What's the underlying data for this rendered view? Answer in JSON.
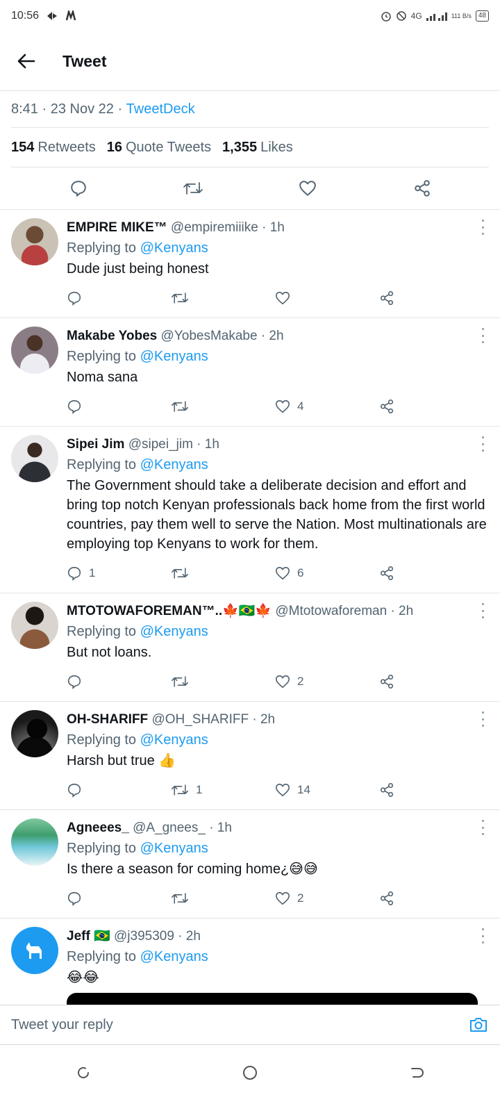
{
  "status_bar": {
    "time": "10:56",
    "network": "4G",
    "speed": "111 B/s",
    "battery": "48"
  },
  "header": {
    "title": "Tweet"
  },
  "tweet_meta": {
    "time": "8:41",
    "date": "23 Nov 22",
    "source": "TweetDeck"
  },
  "stats": {
    "retweets_count": "154",
    "retweets_label": "Retweets",
    "quotes_count": "16",
    "quotes_label": "Quote Tweets",
    "likes_count": "1,355",
    "likes_label": "Likes"
  },
  "replying_label": "Replying to",
  "replies": [
    {
      "name": "EMPIRE MIKE™",
      "handle": "@empiremiiike · 1h",
      "mention": "@Kenyans",
      "text": "Dude just being honest",
      "comments": "",
      "retweets": "",
      "likes": ""
    },
    {
      "name": "Makabe Yobes",
      "handle": "@YobesMakabe · 2h",
      "mention": "@Kenyans",
      "text": "Noma sana",
      "comments": "",
      "retweets": "",
      "likes": "4"
    },
    {
      "name": "Sipei Jim",
      "handle": "@sipei_jim · 1h",
      "mention": "@Kenyans",
      "text": "The Government should take a deliberate decision and effort and bring top notch Kenyan professionals back home from the  first world countries, pay them well to serve the Nation.  Most multinationals are employing top Kenyans to work for them.",
      "comments": "1",
      "retweets": "",
      "likes": "6"
    },
    {
      "name": "MTOTOWAFOREMAN™..🍁🇧🇷🍁",
      "handle": "@Mtotowaforeman · 2h",
      "mention": "@Kenyans",
      "text": "But not loans.",
      "comments": "",
      "retweets": "",
      "likes": "2"
    },
    {
      "name": "OH-SHARIFF",
      "handle": "@OH_SHARIFF · 2h",
      "mention": "@Kenyans",
      "text": "Harsh but true 👍",
      "comments": "",
      "retweets": "1",
      "likes": "14"
    },
    {
      "name": "Agneees_",
      "handle": "@A_gnees_ · 1h",
      "mention": "@Kenyans",
      "text": "Is there a season for coming home¿😅😅",
      "comments": "",
      "retweets": "",
      "likes": "2"
    },
    {
      "name": "Jeff 🇧🇷",
      "handle": "@j395309 · 2h",
      "mention": "@Kenyans",
      "text": "😂😂"
    }
  ],
  "composer": {
    "placeholder": "Tweet your reply"
  },
  "colors": {
    "accent": "#1d9bf0",
    "muted": "#536471",
    "text": "#0f1419"
  }
}
